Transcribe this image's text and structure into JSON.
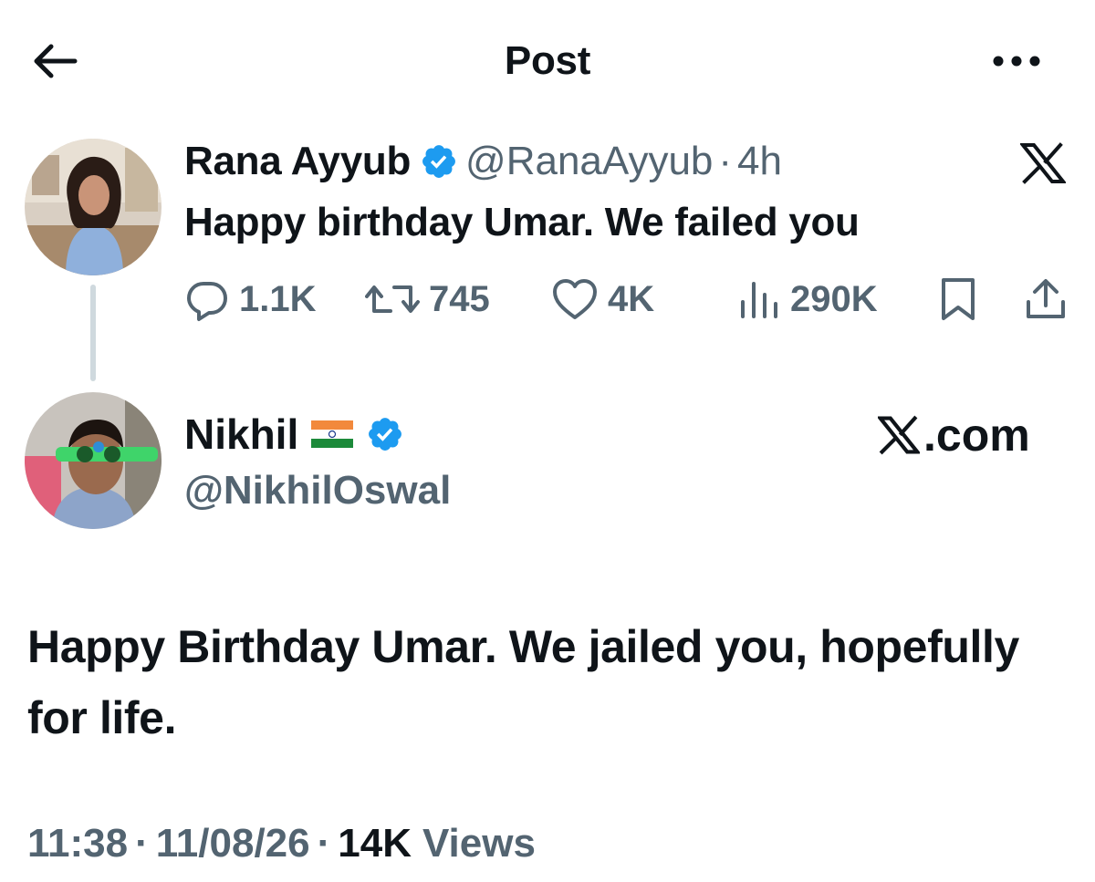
{
  "header": {
    "title": "Post",
    "back_icon": "arrow-left-icon",
    "more_icon": "more-horizontal-icon"
  },
  "parent_tweet": {
    "author_name": "Rana Ayyub",
    "author_handle": "@RanaAyyub",
    "separator": "·",
    "time": "4h",
    "text": "Happy birthday Umar. We failed you",
    "source_icon": "x-logo-icon",
    "stats": {
      "replies": "1.1K",
      "reposts": "745",
      "likes": "4K",
      "views": "290K"
    }
  },
  "reply_tweet": {
    "author_name": "Nikhil",
    "author_flag": "india-flag-icon",
    "author_handle": "@NikhilOswal",
    "watermark": ".com",
    "text": "Happy Birthday Umar. We jailed you, hopefully for life.",
    "time": "11:38",
    "date": "11/08/26",
    "views_count": "14K",
    "views_label": "Views",
    "separator": "·"
  },
  "colors": {
    "text_primary": "#0f1419",
    "text_secondary": "#536471",
    "verified_blue": "#1d9bf0",
    "thread_line": "#cfd9de"
  }
}
